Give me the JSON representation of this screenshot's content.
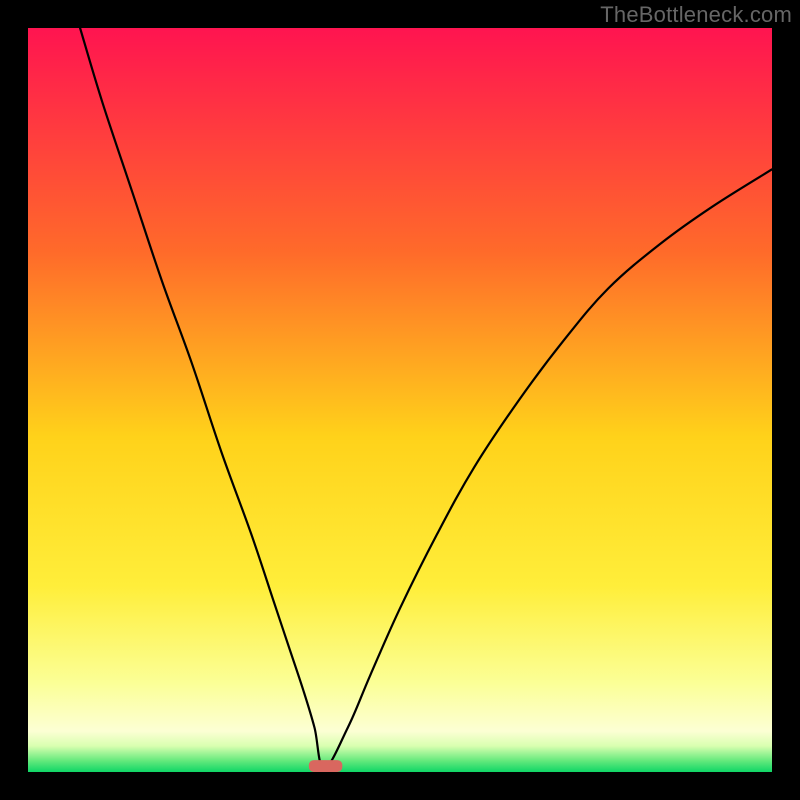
{
  "watermark": "TheBottleneck.com",
  "chart_data": {
    "type": "line",
    "title": "",
    "xlabel": "",
    "ylabel": "",
    "xlim": [
      0,
      100
    ],
    "ylim": [
      0,
      100
    ],
    "axis_ticks_visible": false,
    "legend_visible": false,
    "grid": false,
    "background_gradient_stops": [
      {
        "pos": 0.0,
        "color": "#ff1450"
      },
      {
        "pos": 0.3,
        "color": "#ff6a2a"
      },
      {
        "pos": 0.55,
        "color": "#ffd21a"
      },
      {
        "pos": 0.75,
        "color": "#ffee3a"
      },
      {
        "pos": 0.88,
        "color": "#fbff96"
      },
      {
        "pos": 0.945,
        "color": "#fcffd4"
      },
      {
        "pos": 0.965,
        "color": "#d9ffb0"
      },
      {
        "pos": 0.985,
        "color": "#63e97c"
      },
      {
        "pos": 1.0,
        "color": "#0fd666"
      }
    ],
    "minimum_marker": {
      "x": 40,
      "y": 0,
      "width": 4.5,
      "height": 1.6,
      "color": "#d9675f"
    },
    "series": [
      {
        "name": "bottleneck-curve",
        "x": [
          7,
          10,
          14,
          18,
          22,
          26,
          30,
          33,
          35,
          37,
          38.5,
          39.8,
          43,
          46,
          50,
          55,
          60,
          66,
          72,
          78,
          85,
          92,
          100
        ],
        "values": [
          100,
          90,
          78,
          66,
          55,
          43,
          32,
          23,
          17,
          11,
          6,
          0.5,
          6,
          13,
          22,
          32,
          41,
          50,
          58,
          65,
          71,
          76,
          81
        ]
      }
    ]
  }
}
